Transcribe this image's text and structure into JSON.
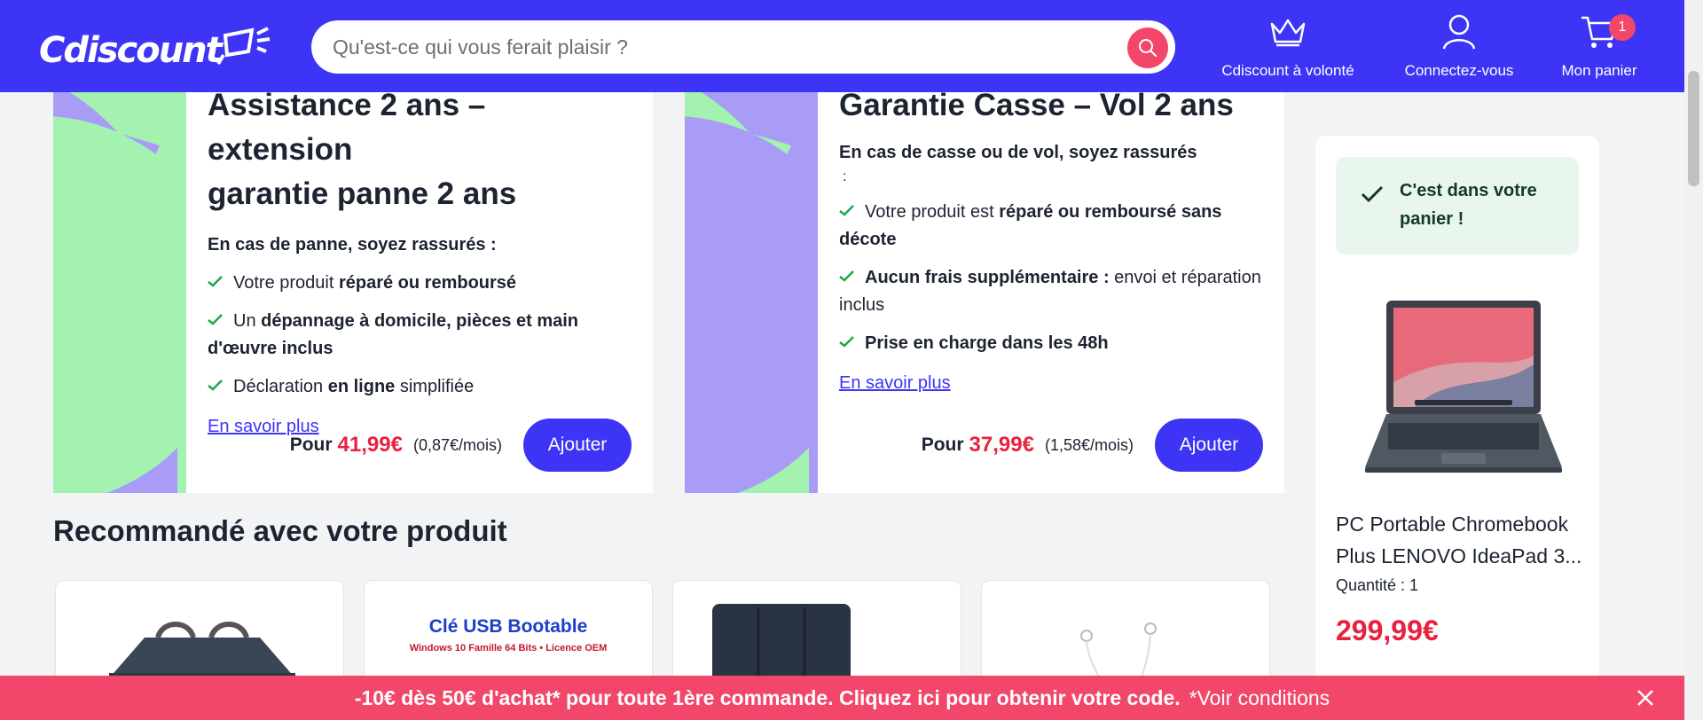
{
  "header": {
    "logo_text": "Cdiscount",
    "search_placeholder": "Qu'est-ce qui vous ferait plaisir ?",
    "volonte_label": "Cdiscount à volonté",
    "connect_label": "Connectez-vous",
    "cart_label": "Mon panier",
    "cart_count": "1"
  },
  "warranty_cards": [
    {
      "title_line1": "Assistance 2 ans – extension",
      "title_line2": "garantie panne 2 ans",
      "subtitle": "En cas de panne, soyez rassurés :",
      "items": [
        {
          "pre": "Votre produit ",
          "bold": "réparé ou remboursé",
          "post": ""
        },
        {
          "pre": "Un ",
          "bold": "dépannage à domicile, pièces et main d'œuvre inclus",
          "post": ""
        },
        {
          "pre": "Déclaration ",
          "bold": "en ligne",
          "post": " simplifiée"
        }
      ],
      "link": "En savoir plus",
      "pour": "Pour",
      "price": "41,99€",
      "monthly": "(0,87€/mois)",
      "button": "Ajouter"
    },
    {
      "title_line1": "Garantie Casse – Vol 2 ans",
      "subtitle": "En cas de casse ou de vol, soyez rassurés",
      "subtitle_colon": ":",
      "items": [
        {
          "pre": "Votre produit est ",
          "bold": "réparé ou remboursé sans décote",
          "post": ""
        },
        {
          "pre": "",
          "bold": "Aucun frais supplémentaire :",
          "post": " envoi et réparation inclus"
        },
        {
          "pre": "",
          "bold": "Prise en charge dans les 48h",
          "post": ""
        }
      ],
      "link": "En savoir plus",
      "pour": "Pour",
      "price": "37,99€",
      "monthly": "(1,58€/mois)",
      "button": "Ajouter"
    }
  ],
  "recommended": {
    "title": "Recommandé avec votre produit",
    "usb_title": "Clé USB Bootable",
    "usb_subtitle": "Windows 10 Famille 64 Bits • Licence OEM"
  },
  "cart_panel": {
    "confirmation": "C'est dans votre panier !",
    "product_name": "PC Portable Chromebook Plus LENOVO IdeaPad 3...",
    "quantity": "Quantité : 1",
    "price": "299,99€"
  },
  "promo": {
    "text": "-10€ dès 50€ d'achat* pour toute 1ère commande. Cliquez ici pour obtenir votre code.",
    "conditions": "*Voir conditions"
  },
  "colors": {
    "brand_blue": "#3d34f5",
    "promo_pink": "#f2476a",
    "price_red": "#e8213f",
    "art_green": "#a4f2b0",
    "art_purple": "#a99cf7",
    "check_green": "#1aa84a"
  }
}
